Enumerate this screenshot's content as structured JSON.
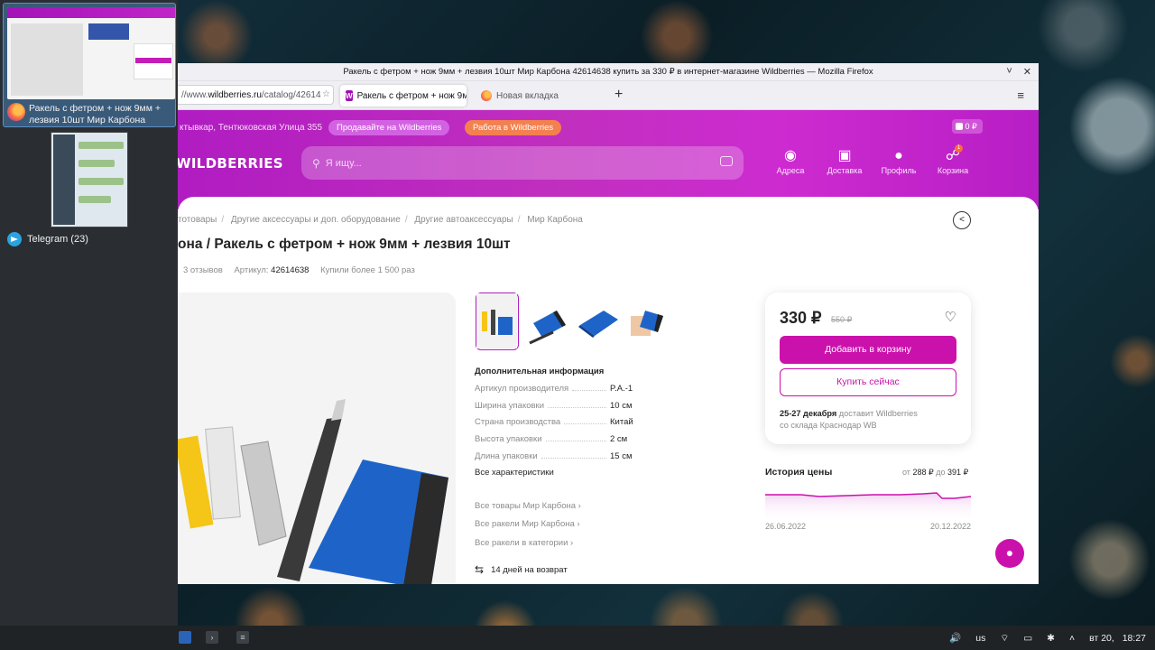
{
  "window": {
    "title": "Ракель с фетром + нож 9мм + лезвия 10шт Мир Карбона 42614638 купить за 330 ₽ в интернет-магазине Wildberries — Mozilla Firefox",
    "controls": [
      "˅",
      "✕"
    ]
  },
  "switcher": {
    "firefox_label": "Ракель с фетром + нож 9мм + лезвия 10шт Мир Карбона 42614…",
    "telegram_label": "Telegram (23)"
  },
  "browser": {
    "url_prefix": "//www.",
    "url_domain": "wildberries.ru",
    "url_path": "/catalog/42614",
    "tabs": [
      {
        "label": "Ракель с фетром + нож 9м",
        "icon": "W"
      },
      {
        "label": "Новая вкладка"
      }
    ],
    "new_tab": "+",
    "menu": "≡"
  },
  "header": {
    "city": "ктывкар, Тентюковская Улица 355",
    "sell_label": "Продавайте на Wildberries",
    "work_label": "Работа в Wildberries",
    "currency_label": "0 ₽",
    "logo": "WILDBERRIES",
    "search_placeholder": "Я ищу...",
    "nav": [
      {
        "icon": "location-pin",
        "label": "Адреса"
      },
      {
        "icon": "box",
        "label": "Доставка"
      },
      {
        "icon": "user",
        "label": "Профиль"
      },
      {
        "icon": "cart",
        "label": "Корзина",
        "badge": "1"
      }
    ]
  },
  "product": {
    "breadcrumbs": [
      "тотовары",
      "Другие аксессуары и доп. оборудование",
      "Другие автоаксессуары",
      "Мир Карбона"
    ],
    "title": "она / Ракель с фетром + нож 9мм + лезвия 10шт",
    "reviews": "3 отзывов",
    "article_label": "Артикул:",
    "article_value": "42614638",
    "bought": "Купили более 1 500 раз",
    "info_title": "Дополнительная информация",
    "specs": [
      {
        "name": "Артикул производителя",
        "value": "P.A.-1"
      },
      {
        "name": "Ширина упаковки",
        "value": "10 см"
      },
      {
        "name": "Страна производства",
        "value": "Китай"
      },
      {
        "name": "Высота упаковки",
        "value": "2 см"
      },
      {
        "name": "Длина упаковки",
        "value": "15 см"
      }
    ],
    "all_chars": "Все характеристики",
    "links": [
      "Все товары Мир Карбона ›",
      "Все ракели Мир Карбона ›",
      "Все ракели в категории ›"
    ],
    "return_text": "14 дней на возврат"
  },
  "price": {
    "current": "330 ₽",
    "old": "550 ₽",
    "add_to_cart": "Добавить в корзину",
    "buy_now": "Купить сейчас",
    "delivery_date": "25-27 декабря",
    "delivery_rest": "доставит Wildberries",
    "delivery_from": "со склада Краснодар WB"
  },
  "history": {
    "title": "История цены",
    "from_label": "от",
    "min": "288 ₽",
    "to_label": "до",
    "max": "391 ₽",
    "date_start": "26.06.2022",
    "date_end": "20.12.2022"
  },
  "taskbar": {
    "volume_icon": "🔊",
    "layout": "us",
    "date": "вт 20,",
    "time": "18:27"
  },
  "colors": {
    "brand": "#cb11ab",
    "header_purple": "#b01cc1"
  }
}
